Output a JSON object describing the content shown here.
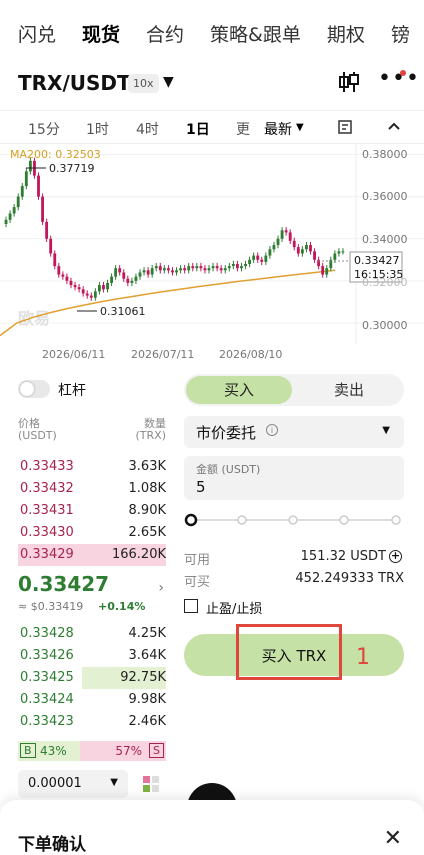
{
  "tabs": [
    "闪兑",
    "现货",
    "合约",
    "策略&跟单",
    "期权",
    "镑"
  ],
  "pair": {
    "name": "TRX/USDT",
    "leverage": "10x"
  },
  "timeframes": [
    "15分",
    "1时",
    "4时",
    "1日",
    "更",
    "最新"
  ],
  "chart": {
    "ma_label": "MA200: 0.32503",
    "high_label": "0.37719",
    "low_label": "0.31061",
    "price_tag": "0.33427",
    "countdown": "16:15:35",
    "watermark": "欧易",
    "y_ticks": [
      "0.38000",
      "0.36000",
      "0.34000",
      "0.32000",
      "0.30000"
    ],
    "x_ticks": [
      "2026/06/11",
      "2026/07/11",
      "2026/08/10"
    ],
    "colors": {
      "up": "#2e7d32",
      "down": "#c2185b",
      "ma": "#e0a030"
    }
  },
  "chart_data": {
    "type": "candlestick",
    "title": "",
    "ylim": [
      0.29,
      0.385
    ],
    "y_ticks": [
      0.38,
      0.36,
      0.34,
      0.32,
      0.3
    ],
    "x_ticks": [
      "2026/06/11",
      "2026/07/11",
      "2026/08/10"
    ],
    "series": [
      {
        "name": "MA200",
        "last": 0.32503
      }
    ],
    "high": 0.37719,
    "low": 0.31061,
    "last_price": 0.33427
  },
  "leverage_toggle": {
    "label": "杠杆"
  },
  "orderbook": {
    "header_price": "价格",
    "header_price_unit": "(USDT)",
    "header_qty": "数量",
    "header_qty_unit": "(TRX)",
    "asks": [
      {
        "price": "0.33433",
        "qty": "3.63K"
      },
      {
        "price": "0.33432",
        "qty": "1.08K"
      },
      {
        "price": "0.33431",
        "qty": "8.90K"
      },
      {
        "price": "0.33430",
        "qty": "2.65K"
      },
      {
        "price": "0.33429",
        "qty": "166.20K"
      }
    ],
    "last_price": "0.33427",
    "last_price_usd": "≈ $0.33419",
    "change": "+0.14%",
    "bids": [
      {
        "price": "0.33428",
        "qty": "4.25K"
      },
      {
        "price": "0.33426",
        "qty": "3.64K"
      },
      {
        "price": "0.33425",
        "qty": "92.75K"
      },
      {
        "price": "0.33424",
        "qty": "9.98K"
      },
      {
        "price": "0.33423",
        "qty": "2.46K"
      }
    ],
    "ratio_b_label": "B",
    "ratio_b": "43%",
    "ratio_s": "57%",
    "ratio_s_label": "S",
    "precision": "0.00001"
  },
  "trade": {
    "buy_tab": "买入",
    "sell_tab": "卖出",
    "order_type": "市价委托",
    "amount_label": "金额 (USDT)",
    "amount_value": "5",
    "available_label": "可用",
    "available_value": "151.32 USDT",
    "can_buy_label": "可买",
    "can_buy_value": "452.249333 TRX",
    "tpsl_label": "止盈/止损",
    "buy_button": "买入 TRX",
    "annotation_number": "1"
  },
  "sheet": {
    "title": "下单确认"
  }
}
